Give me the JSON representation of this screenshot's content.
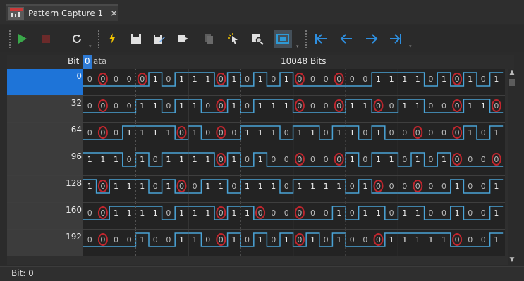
{
  "tab": {
    "title": "Pattern Capture 1",
    "close": "×"
  },
  "toolbar": {
    "buttons": [
      {
        "name": "run-icon",
        "color": "#3aa84a"
      },
      {
        "name": "stop-icon",
        "color": "#7a2f2f"
      },
      {
        "name": "reset-icon",
        "color": "#dcdcdc"
      },
      {
        "name": "trigger-icon",
        "color": "#f2c400"
      },
      {
        "name": "save-icon",
        "color": "#e0e0e0"
      },
      {
        "name": "save-as-icon",
        "color": "#6ea7e8"
      },
      {
        "name": "export-icon",
        "color": "#e0e0e0"
      },
      {
        "name": "copy-icon",
        "color": "#6a6a6a"
      },
      {
        "name": "select-cursor-icon",
        "color": "#e0e0e0"
      },
      {
        "name": "search-icon",
        "color": "#e0e0e0"
      },
      {
        "name": "display-mode-icon",
        "color": "#2e9ad6"
      },
      {
        "name": "jump-first-icon",
        "color": "#2e8fe0"
      },
      {
        "name": "prev-icon",
        "color": "#2e8fe0"
      },
      {
        "name": "next-icon",
        "color": "#2e8fe0"
      },
      {
        "name": "jump-last-icon",
        "color": "#2e8fe0"
      }
    ]
  },
  "grid": {
    "header": {
      "bit": "Bit",
      "selected_bit": "0",
      "data": "ata",
      "total": "10048 Bits"
    },
    "rows": [
      {
        "label": "0",
        "bits": "00000101110101010000001111010101"
      },
      {
        "label": "32",
        "bits": "00001101100101110000110011000110"
      },
      {
        "label": "64",
        "bits": "00011110100011101101101000000101"
      },
      {
        "label": "96",
        "bits": "11101011110101000000101101010000"
      },
      {
        "label": "128",
        "bits": "10111010011011101111010000001001"
      },
      {
        "label": "160",
        "bits": "00111101110110000001011011001001"
      },
      {
        "label": "192",
        "bits": "00001001100101010101000111110001"
      }
    ]
  },
  "colors": {
    "waveform": "#4aa3d6",
    "highlight": "#c0262e",
    "selection": "#1e74d8"
  },
  "status": {
    "text": "Bit: 0"
  }
}
